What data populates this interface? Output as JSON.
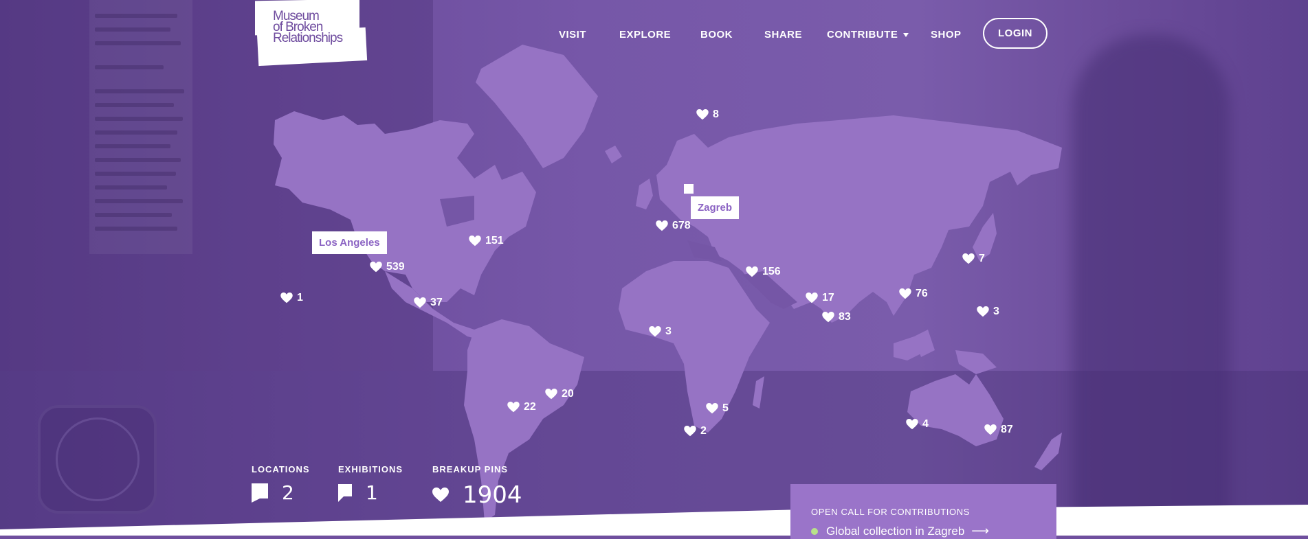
{
  "brand": {
    "logo_lines": [
      "Museum",
      "of Broken",
      "Relationships"
    ]
  },
  "nav": {
    "items": [
      "VISIT",
      "EXPLORE",
      "BOOK",
      "SHARE",
      "CONTRIBUTE",
      "SHOP"
    ],
    "login": "LOGIN"
  },
  "map": {
    "tooltips": [
      "Los Angeles",
      "Zagreb"
    ],
    "pins": [
      "8",
      "678",
      "151",
      "539",
      "1",
      "37",
      "156",
      "17",
      "83",
      "76",
      "7",
      "3",
      "3",
      "20",
      "22",
      "5",
      "2",
      "4",
      "87"
    ]
  },
  "stats": {
    "locations": {
      "label": "LOCATIONS",
      "value": "2"
    },
    "exhibitions": {
      "label": "EXHIBITIONS",
      "value": "1"
    },
    "pins": {
      "label": "BREAKUP PINS",
      "value": "1904"
    }
  },
  "open_call": {
    "title": "OPEN CALL FOR CONTRIBUTIONS",
    "link": "Global collection in Zagreb"
  },
  "colors": {
    "map_land": "#9673c4",
    "accent": "#8b63c3",
    "background": "#6f4f9e"
  }
}
